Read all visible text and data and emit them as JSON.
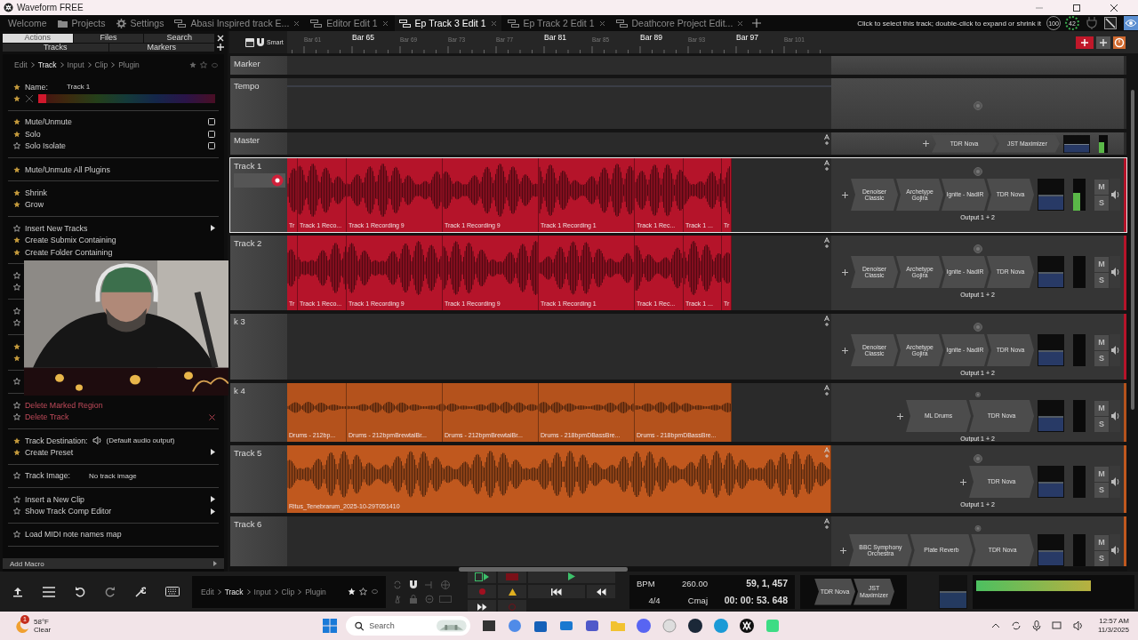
{
  "window": {
    "title": "Waveform FREE"
  },
  "tabs": [
    {
      "label": "Welcome",
      "kind": "plain",
      "selected": false
    },
    {
      "label": "Projects",
      "kind": "folder",
      "selected": false
    },
    {
      "label": "Settings",
      "kind": "gear",
      "selected": false
    },
    {
      "label": "Abasi Inspired track E...",
      "kind": "edit",
      "selected": false
    },
    {
      "label": "Editor Edit 1",
      "kind": "edit",
      "selected": false
    },
    {
      "label": "Ep Track 3 Edit 1",
      "kind": "edit",
      "selected": true
    },
    {
      "label": "Ep Track 2 Edit 1",
      "kind": "edit",
      "selected": false
    },
    {
      "label": "Deathcore Project Edit...",
      "kind": "edit",
      "selected": false
    }
  ],
  "hint": "Click to select this track; double-click to expand or shrink it",
  "gauges": [
    {
      "label": "100",
      "kind": "plain"
    },
    {
      "label": "42",
      "kind": "arc"
    }
  ],
  "sidebar": {
    "tabs": [
      {
        "label": "Actions",
        "selected": true
      },
      {
        "label": "Files",
        "selected": false
      },
      {
        "label": "Search",
        "selected": false
      },
      {
        "label": "Tracks",
        "selected": false
      },
      {
        "label": "Markers",
        "selected": false
      }
    ],
    "breadcrumb": [
      {
        "label": "Edit",
        "selected": false
      },
      {
        "label": "Track",
        "selected": true
      },
      {
        "label": "Input",
        "selected": false
      },
      {
        "label": "Clip",
        "selected": false
      },
      {
        "label": "Plugin",
        "selected": false
      }
    ],
    "groups": [
      [
        {
          "kind": "field",
          "label": "Name:",
          "value": "Track 1",
          "starred": true
        },
        {
          "kind": "colors",
          "starred": true
        }
      ],
      [
        {
          "kind": "check",
          "label": "Mute/Unmute",
          "starred": true,
          "checked": false
        },
        {
          "kind": "check",
          "label": "Solo",
          "starred": true,
          "checked": false
        },
        {
          "kind": "check",
          "label": "Solo Isolate",
          "starred": false,
          "checked": false
        }
      ],
      [
        {
          "kind": "action",
          "label": "Mute/Unmute All Plugins",
          "starred": true
        }
      ],
      [
        {
          "kind": "action",
          "label": "Shrink",
          "starred": true
        },
        {
          "kind": "action",
          "label": "Grow",
          "starred": true
        }
      ],
      [
        {
          "kind": "submenu",
          "label": "Insert New Tracks",
          "starred": false
        },
        {
          "kind": "action",
          "label": "Create Submix Containing",
          "starred": true
        },
        {
          "kind": "action",
          "label": "Create Folder Containing",
          "starred": true
        }
      ],
      [
        {
          "kind": "covered",
          "starred": false
        },
        {
          "kind": "covered",
          "starred": false
        }
      ],
      [
        {
          "kind": "covered",
          "starred": false
        },
        {
          "kind": "covered",
          "starred": false
        }
      ],
      [
        {
          "kind": "covered",
          "starred": true
        },
        {
          "kind": "covered",
          "starred": true
        }
      ],
      [
        {
          "kind": "covered",
          "starred": false
        }
      ],
      [
        {
          "kind": "danger",
          "label": "Delete Marked Region",
          "starred": false
        },
        {
          "kind": "delete",
          "label": "Delete Track",
          "starred": false
        }
      ],
      [
        {
          "kind": "output",
          "label": "Track Destination:",
          "value": "(Default audio output)",
          "starred": true
        },
        {
          "kind": "submenu",
          "label": "Create Preset",
          "starred": true
        }
      ],
      [
        {
          "kind": "field",
          "label": "Track Image:",
          "value": "No track image",
          "starred": false
        }
      ],
      [
        {
          "kind": "submenu",
          "label": "Insert a New Clip",
          "starred": false
        },
        {
          "kind": "submenu",
          "label": "Show Track Comp Editor",
          "starred": false
        }
      ],
      [
        {
          "kind": "action",
          "label": "Load MIDI note names map",
          "starred": false
        }
      ]
    ],
    "add_macro": "Add Macro"
  },
  "ruler": {
    "mode": "Smart",
    "bars": [
      {
        "label": "Bar 61",
        "major": false
      },
      {
        "label": "Bar 65",
        "major": true
      },
      {
        "label": "Bar 69",
        "major": false
      },
      {
        "label": "Bar 73",
        "major": false
      },
      {
        "label": "Bar 77",
        "major": false
      },
      {
        "label": "Bar 81",
        "major": true
      },
      {
        "label": "Bar 85",
        "major": false
      },
      {
        "label": "Bar 89",
        "major": true
      },
      {
        "label": "Bar 93",
        "major": false
      },
      {
        "label": "Bar 97",
        "major": true
      },
      {
        "label": "Bar 101",
        "major": false
      }
    ]
  },
  "tracks": [
    {
      "name": "Marker",
      "kind": "marker",
      "selected": false
    },
    {
      "name": "Tempo",
      "kind": "tempo",
      "selected": false
    },
    {
      "name": "Master",
      "kind": "master",
      "selected": false,
      "plugins": [
        "TDR Nova",
        "JST Maximizer"
      ],
      "level": 0.6
    },
    {
      "name": "Track 1",
      "kind": "audio",
      "selected": true,
      "armed": true,
      "color": "#b5142a",
      "level": 0.55,
      "output": "Output 1 + 2",
      "buttons": [
        "M",
        "S"
      ],
      "plugins": [
        "Denoiser Classic",
        "Archetype Gojira",
        "Ignite - NadIR",
        "TDR Nova"
      ],
      "clips": [
        {
          "label": "Tr"
        },
        {
          "label": "Track 1 Reco..."
        },
        {
          "label": "Track 1 Recording 9"
        },
        {
          "label": "Track 1 Recording 9"
        },
        {
          "label": "Track 1 Recording 1"
        },
        {
          "label": "Track 1 Rec..."
        },
        {
          "label": "Track 1 ..."
        },
        {
          "label": "Tr"
        }
      ]
    },
    {
      "name": "Track 2",
      "kind": "audio",
      "selected": false,
      "armed": false,
      "color": "#b5142a",
      "level": 0,
      "output": "Output 1 + 2",
      "buttons": [
        "M",
        "S"
      ],
      "plugins": [
        "Denoiser Classic",
        "Archetype Gojira",
        "Ignite - NadIR",
        "TDR Nova"
      ],
      "clips": [
        {
          "label": "Tr"
        },
        {
          "label": "Track 1 Reco..."
        },
        {
          "label": "Track 1 Recording 9"
        },
        {
          "label": "Track 1 Recording 9"
        },
        {
          "label": "Track 1 Recording 1"
        },
        {
          "label": "Track 1 Rec..."
        },
        {
          "label": "Track 1 ..."
        },
        {
          "label": "Tr"
        }
      ]
    },
    {
      "name": "k 3",
      "kind": "audio",
      "selected": false,
      "armed": false,
      "color": "#b5142a",
      "level": 0,
      "output": "Output 1 + 2",
      "buttons": [
        "M",
        "S"
      ],
      "plugins": [
        "Denoiser Classic",
        "Archetype Gojira",
        "Ignite - NadIR",
        "TDR Nova"
      ]
    },
    {
      "name": "k 4",
      "kind": "audio",
      "selected": false,
      "armed": false,
      "color": "#b4521c",
      "level": 0,
      "output": "Output 1 + 2",
      "buttons": [
        "M",
        "S"
      ],
      "plugins": [
        "ML Drums",
        "TDR Nova"
      ],
      "clips": [
        {
          "label": "Drums - 212bp..."
        },
        {
          "label": "Drums - 212bpmBrewtalBr..."
        },
        {
          "label": "Drums - 212bpmBrewtalBr..."
        },
        {
          "label": "Drums - 218bpmDBassBre..."
        },
        {
          "label": "Drums - 218bpmDBassBre..."
        }
      ]
    },
    {
      "name": "Track 5",
      "kind": "audio",
      "selected": false,
      "armed": false,
      "color": "#c0581e",
      "level": 0,
      "output": "Output 1 + 2",
      "buttons": [
        "M",
        "S"
      ],
      "plugins": [
        "TDR Nova"
      ],
      "clips": [
        {
          "label": "Ritus_Tenebrarum_2025-10-29T051410"
        }
      ]
    },
    {
      "name": "Track 6",
      "kind": "audio",
      "selected": false,
      "armed": false,
      "color": "#c0581e",
      "level": 0,
      "buttons": [
        "M",
        "S"
      ],
      "plugins": [
        "BBC Symphony Orchestra",
        "Plate Reverb",
        "TDR Nova"
      ]
    }
  ],
  "bottom": {
    "breadcrumb": [
      {
        "label": "Edit",
        "selected": false
      },
      {
        "label": "Track",
        "selected": true
      },
      {
        "label": "Input",
        "selected": false
      },
      {
        "label": "Clip",
        "selected": false
      },
      {
        "label": "Plugin",
        "selected": false
      }
    ],
    "bpm_label": "BPM",
    "bpm": "260.00",
    "signature": "4/4",
    "key": "Cmaj",
    "position": "59, 1, 457",
    "time": "00: 00: 53. 648",
    "plugins": [
      "TDR Nova",
      "JST Maximizer"
    ],
    "meter": {
      "level": 0.74
    }
  },
  "taskbar": {
    "badge": "1",
    "temperature": "58°F",
    "weather": "Clear",
    "search": {
      "placeholder": "Search"
    },
    "time": "12:57 AM",
    "date": "11/3/2025"
  }
}
